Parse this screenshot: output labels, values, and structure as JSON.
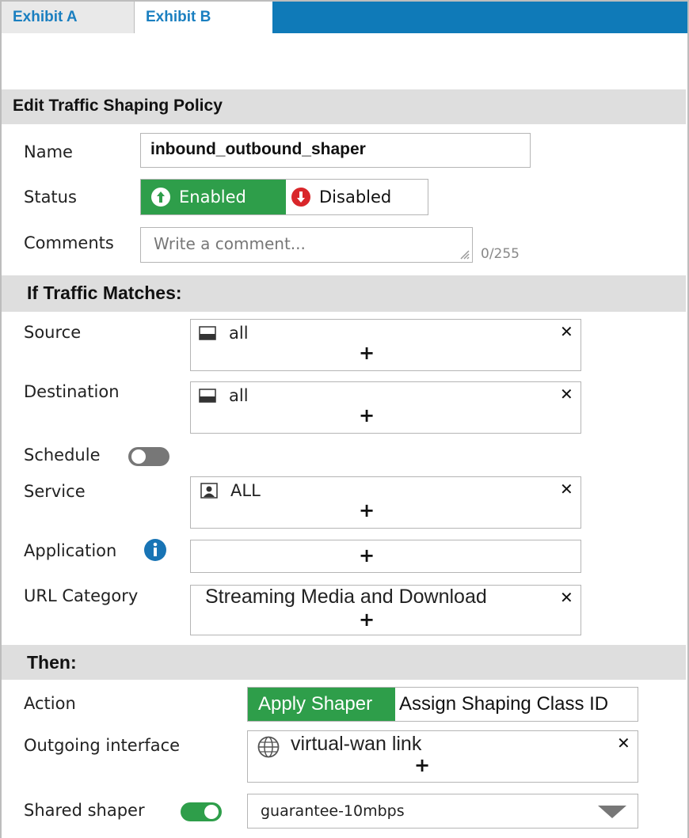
{
  "tabs": [
    {
      "label": "Exhibit A"
    },
    {
      "label": "Exhibit B"
    }
  ],
  "form": {
    "title": "Edit Traffic Shaping Policy",
    "name_label": "Name",
    "name_value": "inbound_outbound_shaper",
    "status_label": "Status",
    "status_enabled": "Enabled",
    "status_disabled": "Disabled",
    "comments_label": "Comments",
    "comments_placeholder": "Write a comment...",
    "comments_counter": "0/255"
  },
  "match": {
    "title": "If Traffic Matches:",
    "source_label": "Source",
    "source_value": "all",
    "destination_label": "Destination",
    "destination_value": "all",
    "schedule_label": "Schedule",
    "schedule_on": false,
    "service_label": "Service",
    "service_value": "ALL",
    "application_label": "Application",
    "url_category_label": "URL Category",
    "url_category_value": "Streaming Media and Download"
  },
  "then": {
    "title": "Then:",
    "action_label": "Action",
    "action_apply": "Apply Shaper",
    "action_assign": "Assign Shaping Class ID",
    "outgoing_label": "Outgoing interface",
    "outgoing_value": "virtual-wan link",
    "shared_label": "Shared shaper",
    "shared_on": true,
    "shared_value": "guarantee-10mbps"
  },
  "colors": {
    "accent_blue": "#0f7ab8",
    "enabled_green": "#2e9e4a",
    "disabled_red": "#d9262a",
    "header_gray": "#dedede"
  }
}
